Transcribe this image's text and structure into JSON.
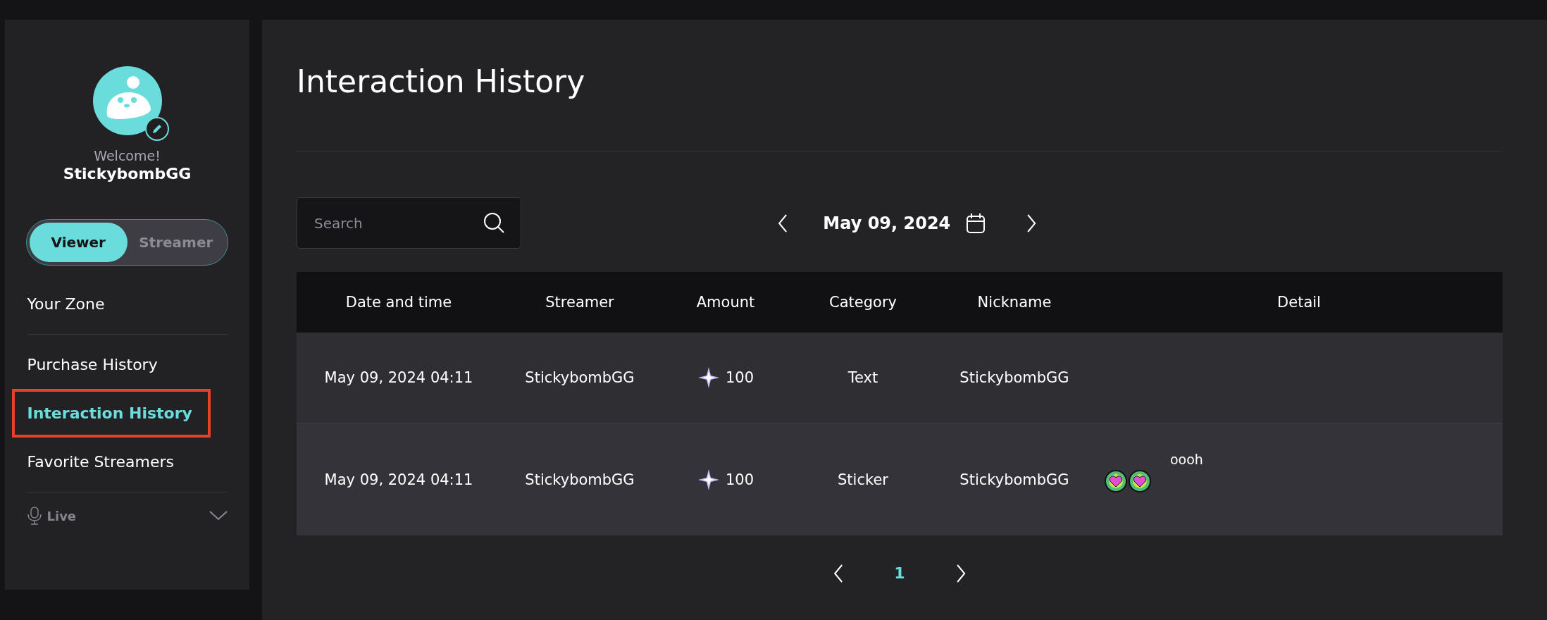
{
  "sidebar": {
    "welcome": "Welcome!",
    "username": "StickybombGG",
    "role_toggle": [
      {
        "label": "Viewer",
        "selected": true
      },
      {
        "label": "Streamer",
        "selected": false
      }
    ],
    "sections": [
      {
        "items": [
          {
            "label": "Your Zone",
            "selected": false
          }
        ]
      },
      {
        "items": [
          {
            "label": "Purchase History",
            "selected": false
          },
          {
            "label": "Interaction History",
            "selected": true,
            "highlighted": true
          },
          {
            "label": "Favorite Streamers",
            "selected": false
          }
        ]
      }
    ],
    "live": {
      "label": "Live",
      "expanded": false
    }
  },
  "main": {
    "title": "Interaction History",
    "search": {
      "placeholder": "Search"
    },
    "date": "May 09, 2024",
    "table": {
      "columns": [
        "Date and time",
        "Streamer",
        "Amount",
        "Category",
        "Nickname",
        "Detail"
      ],
      "rows": [
        {
          "date_time": "May 09, 2024 04:11",
          "streamer": "StickybombGG",
          "amount": "100",
          "category": "Text",
          "nickname": "StickybombGG"
        },
        {
          "date_time": "May 09, 2024 04:11",
          "streamer": "StickybombGG",
          "amount": "100",
          "category": "Sticker",
          "nickname": "StickybombGG",
          "detail": {
            "kind": "sticker",
            "text": "oooh"
          }
        }
      ]
    },
    "pagination": {
      "pages": [
        {
          "label": "1",
          "selected": true
        }
      ]
    }
  }
}
